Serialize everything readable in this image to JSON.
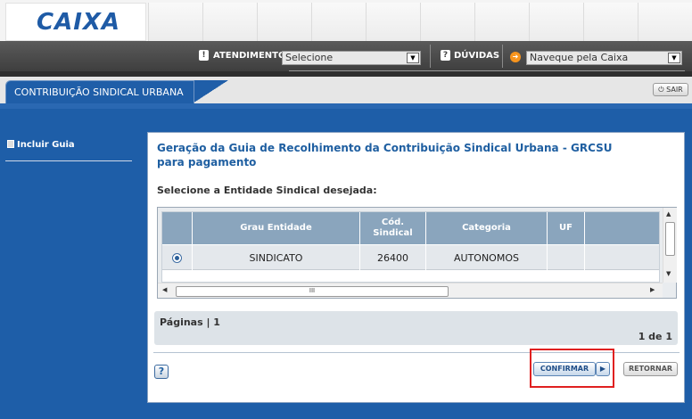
{
  "brand": {
    "logo_text": "CAIXA",
    "color": "#1f5ba6",
    "accent": "#f7941d"
  },
  "nav": {
    "atendimento_label": "ATENDIMENTO",
    "atendimento_value": "Selecione",
    "duvidas_label": "DÚVIDAS",
    "navegue_value": "Naveque pela Caixa"
  },
  "tab": {
    "label": "CONTRIBUIÇÃO SINDICAL URBANA"
  },
  "sair": {
    "label": "SAIR"
  },
  "sidebar": {
    "items": [
      {
        "label": "Incluir Guia"
      }
    ]
  },
  "panel": {
    "title": "Geração da Guia de Recolhimento da Contribuição Sindical Urbana - GRCSU para pagamento",
    "subtitle": "Selecione a Entidade Sindical desejada:"
  },
  "table": {
    "columns": [
      "",
      "Grau Entidade",
      "Cód. Sindical",
      "Categoria",
      "UF",
      ""
    ],
    "rows": [
      {
        "grau": "SINDICATO",
        "codigo": "26400",
        "categoria": "AUTONOMOS",
        "uf": ""
      }
    ],
    "hscroll_grip": "III"
  },
  "pager": {
    "label": "Páginas | 1",
    "count": "1 de 1"
  },
  "actions": {
    "help": "?",
    "confirm": "CONFIRMAR",
    "back": "RETORNAR"
  },
  "icons": {
    "atendimento": "info-icon",
    "duvidas": "info-icon",
    "navegue": "orange-arrow-icon",
    "sair": "power-icon",
    "confirm": "play-icon"
  }
}
